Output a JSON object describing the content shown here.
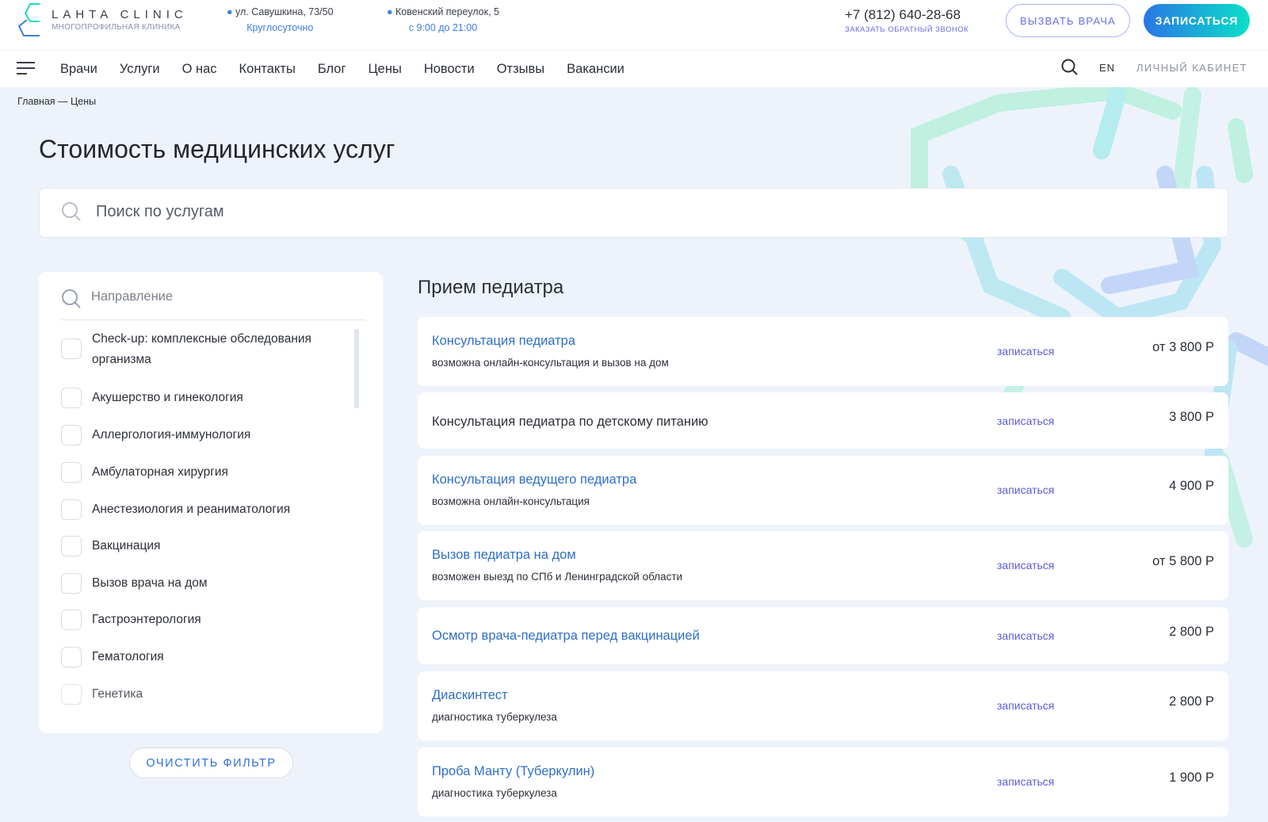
{
  "header": {
    "logo_title": "LAHTA CLINIC",
    "logo_subtitle": "МНОГОПРОФИЛЬНАЯ КЛИНИКА",
    "addresses": [
      {
        "address": "ул. Савушкина, 73/50",
        "hours": "Круглосуточно"
      },
      {
        "address": "Ковенский переулок, 5",
        "hours": "с 9:00 до 21:00"
      }
    ],
    "phone": "+7 (812) 640-28-68",
    "callback": "ЗАКАЗАТЬ ОБРАТНЫЙ ЗВОНОК",
    "call_doctor": "ВЫЗВАТЬ ВРАЧА",
    "signup": "ЗАПИСАТЬСЯ"
  },
  "nav": {
    "items": [
      "Врачи",
      "Услуги",
      "О нас",
      "Контакты",
      "Блог",
      "Цены",
      "Новости",
      "Отзывы",
      "Вакансии"
    ],
    "lang": "EN",
    "account": "ЛИЧНЫЙ КАБИНЕТ"
  },
  "breadcrumb": {
    "home": "Главная",
    "sep": "—",
    "current": "Цены"
  },
  "page_title": "Стоимость медицинских услуг",
  "search": {
    "placeholder": "Поиск по услугам"
  },
  "filter": {
    "placeholder": "Направление",
    "items": [
      "Check-up: комплексные обследования организма",
      "Акушерство и гинекология",
      "Аллергология-иммунология",
      "Амбулаторная хирургия",
      "Анестезиология и реаниматология",
      "Вакцинация",
      "Вызов врача на дом",
      "Гастроэнтерология",
      "Гематология",
      "Генетика"
    ],
    "clear": "ОЧИСТИТЬ ФИЛЬТР"
  },
  "section": {
    "title": "Прием педиатра",
    "book_label": "записаться",
    "services": [
      {
        "name": "Консультация педиатра",
        "note": "возможна онлайн-консультация и вызов на дом",
        "price": "от 3 800 Р"
      },
      {
        "name": "Консультация педиатра по детскому питанию",
        "note": "",
        "price": "3 800 Р"
      },
      {
        "name": "Консультация ведущего педиатра",
        "note": "возможна онлайн-консультация",
        "price": "4 900 Р"
      },
      {
        "name": "Вызов педиатра на дом",
        "note": "возможен выезд по СПб и Ленинградской области",
        "price": "от 5 800 Р"
      },
      {
        "name": "Осмотр врача-педиатра перед вакцинацией",
        "note": "",
        "price": "2 800 Р"
      },
      {
        "name": "Диаскинтест",
        "note": "диагностика туберкулеза",
        "price": "2 800 Р"
      },
      {
        "name": "Проба Манту (Туберкулин)",
        "note": "диагностика туберкулеза",
        "price": "1 900 Р"
      }
    ]
  }
}
